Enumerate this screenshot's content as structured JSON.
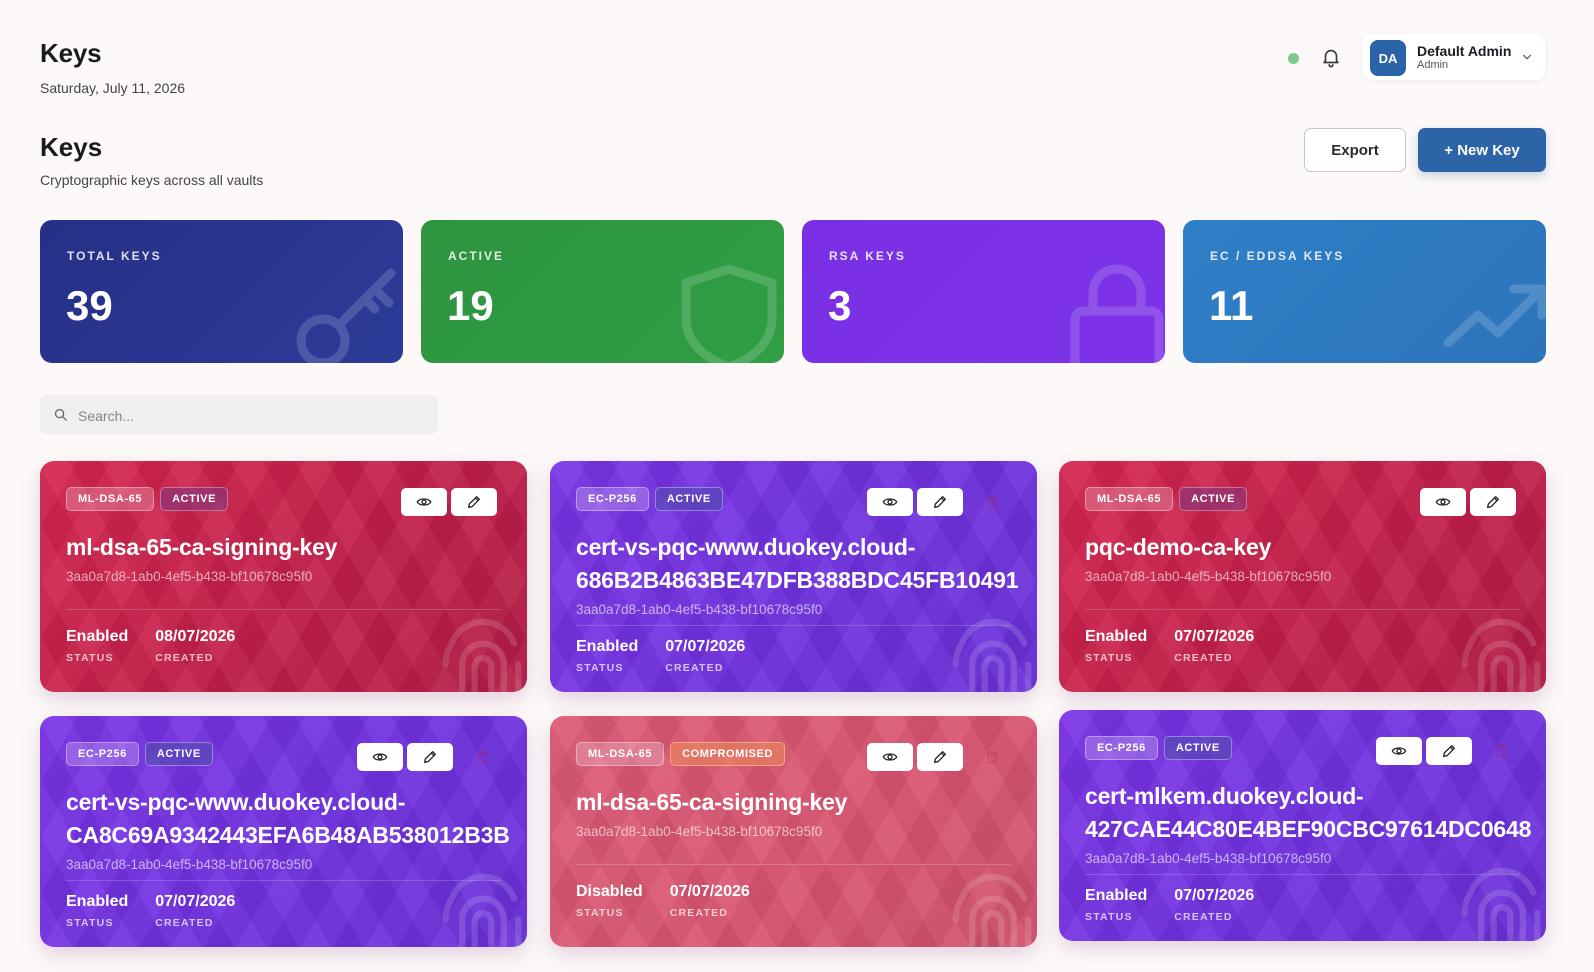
{
  "header": {
    "title": "Keys",
    "date": "Saturday, July 11, 2026",
    "user": {
      "initials": "DA",
      "name": "Default Admin",
      "role": "Admin"
    }
  },
  "page": {
    "title": "Keys",
    "subtitle": "Cryptographic keys across all vaults",
    "export_label": "Export",
    "new_key_label": "+ New Key"
  },
  "stats": [
    {
      "label": "TOTAL KEYS",
      "value": "39",
      "icon": "key-icon"
    },
    {
      "label": "ACTIVE",
      "value": "19",
      "icon": "shield-icon"
    },
    {
      "label": "RSA KEYS",
      "value": "3",
      "icon": "lock-icon"
    },
    {
      "label": "EC / EDDSA KEYS",
      "value": "11",
      "icon": "trend-icon"
    }
  ],
  "search": {
    "placeholder": "Search..."
  },
  "cards": [
    {
      "algo": "ML-DSA-65",
      "state": "ACTIVE",
      "title": "ml-dsa-65-ca-signing-key",
      "id": "3aa0a7d8-1ab0-4ef5-b438-bf10678c95f0",
      "status": "Enabled",
      "status_label": "STATUS",
      "created": "08/07/2026",
      "created_label": "CREATED"
    },
    {
      "algo": "EC-P256",
      "state": "ACTIVE",
      "title": "cert-vs-pqc-www.duokey.cloud-686B2B4863BE47DFB388BDC45FB10491",
      "id": "3aa0a7d8-1ab0-4ef5-b438-bf10678c95f0",
      "status": "Enabled",
      "status_label": "STATUS",
      "created": "07/07/2026",
      "created_label": "CREATED"
    },
    {
      "algo": "ML-DSA-65",
      "state": "ACTIVE",
      "title": "pqc-demo-ca-key",
      "id": "3aa0a7d8-1ab0-4ef5-b438-bf10678c95f0",
      "status": "Enabled",
      "status_label": "STATUS",
      "created": "07/07/2026",
      "created_label": "CREATED"
    },
    {
      "algo": "EC-P256",
      "state": "ACTIVE",
      "title": "cert-vs-pqc-www.duokey.cloud-CA8C69A9342443EFA6B48AB538012B3B",
      "id": "3aa0a7d8-1ab0-4ef5-b438-bf10678c95f0",
      "status": "Enabled",
      "status_label": "STATUS",
      "created": "07/07/2026",
      "created_label": "CREATED"
    },
    {
      "algo": "ML-DSA-65",
      "state": "COMPROMISED",
      "title": "ml-dsa-65-ca-signing-key",
      "id": "3aa0a7d8-1ab0-4ef5-b438-bf10678c95f0",
      "status": "Disabled",
      "status_label": "STATUS",
      "created": "07/07/2026",
      "created_label": "CREATED"
    },
    {
      "algo": "EC-P256",
      "state": "ACTIVE",
      "title": "cert-mlkem.duokey.cloud-427CAE44C80E4BEF90CBC97614DC0648",
      "id": "3aa0a7d8-1ab0-4ef5-b438-bf10678c95f0",
      "status": "Enabled",
      "status_label": "STATUS",
      "created": "07/07/2026",
      "created_label": "CREATED"
    }
  ],
  "colors": {
    "primary": "#2d64a8",
    "stat_total": "#253087",
    "stat_active": "#2e9440",
    "stat_rsa": "#7a2fe4",
    "stat_ec": "#2f7fc7",
    "card_red": "#c21f4a",
    "card_purple": "#7031e0",
    "card_pink": "#d9546f",
    "online": "#7dc98f"
  }
}
